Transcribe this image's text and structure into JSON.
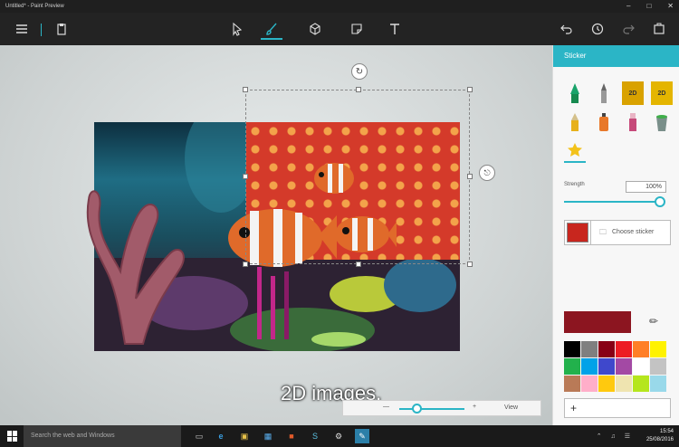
{
  "window": {
    "title": "Untitled* - Paint Preview",
    "controls": [
      "–",
      "□",
      "✕"
    ]
  },
  "toolbar": {
    "menu_icon": "hamburger-icon",
    "paste_icon": "clipboard-icon",
    "tools": [
      {
        "name": "select-tool",
        "icon": "cursor-icon",
        "active": false
      },
      {
        "name": "brush-tool",
        "icon": "brush-icon",
        "active": true
      },
      {
        "name": "3d-tool",
        "icon": "cube-icon",
        "active": false
      },
      {
        "name": "sticker-tool",
        "icon": "sticker-icon",
        "active": false
      },
      {
        "name": "text-tool",
        "icon": "text-icon",
        "active": false
      }
    ],
    "actions": [
      "undo-icon",
      "history-icon",
      "redo-icon",
      "paste-3d-icon"
    ]
  },
  "panel": {
    "title": "Sticker",
    "stickers": [
      {
        "name": "marker",
        "label": ""
      },
      {
        "name": "pencil",
        "label": ""
      },
      {
        "name": "2d-paint",
        "label": "2D"
      },
      {
        "name": "2d-pen",
        "label": "2D"
      },
      {
        "name": "crayon",
        "label": ""
      },
      {
        "name": "spray",
        "label": ""
      },
      {
        "name": "eraser",
        "label": ""
      },
      {
        "name": "bucket",
        "label": ""
      },
      {
        "name": "star",
        "label": ""
      }
    ],
    "strength_label": "Strength",
    "strength_value": "100%",
    "strength_level": 1.0,
    "choose_label": "Choose sticker",
    "current_color": "#8c1520",
    "palette": [
      "#000000",
      "#7f7f7f",
      "#880015",
      "#ed1c24",
      "#ff7f27",
      "#fff200",
      "#22b14c",
      "#00a2e8",
      "#3f48cc",
      "#a349a4",
      "#ffffff",
      "#c3c3c3",
      "#b97a57",
      "#ffaec9",
      "#ffc90e",
      "#efe4b0",
      "#b5e61d",
      "#99d9ea"
    ],
    "add_label": "+"
  },
  "canvas": {
    "caption": "2D images,",
    "zoom": {
      "minus": "—",
      "plus": "+",
      "view": "View"
    }
  },
  "taskbar": {
    "search_placeholder": "Search the web and Windows",
    "time": "15:54",
    "date": "25/08/2016"
  },
  "accent": "#2bb5c6"
}
